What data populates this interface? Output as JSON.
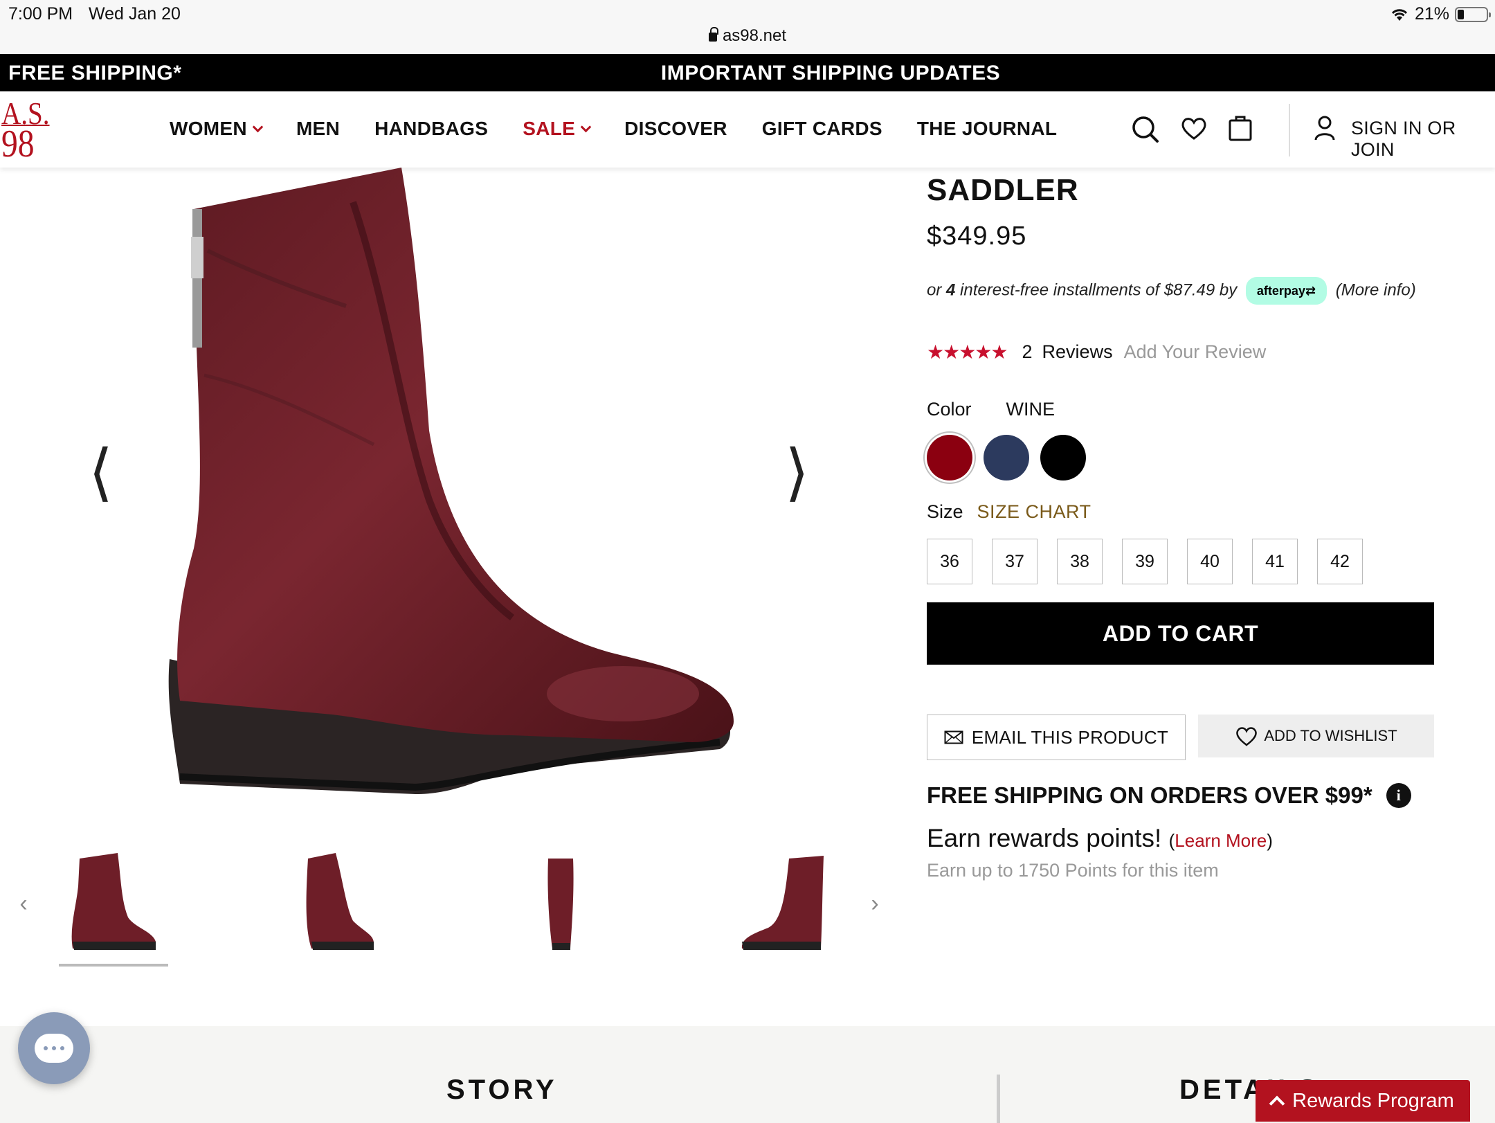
{
  "status": {
    "time": "7:00 PM",
    "date": "Wed Jan 20",
    "url": "as98.net",
    "battery": "21%"
  },
  "promo": {
    "left": "FREE SHIPPING*",
    "center": "IMPORTANT SHIPPING UPDATES"
  },
  "brand": {
    "logo_line1": "A.S.",
    "logo_line2": "98",
    "color": "#b3121f"
  },
  "nav": [
    "WOMEN",
    "MEN",
    "HANDBAGS",
    "SALE",
    "DISCOVER",
    "GIFT CARDS",
    "THE JOURNAL"
  ],
  "header": {
    "signin": "SIGN IN OR JOIN"
  },
  "gallery": {
    "prev": "⟨",
    "next": "⟩",
    "thumb_prev": "‹",
    "thumb_next": "›"
  },
  "product": {
    "title": "SADDLER",
    "price": "$349.95",
    "afterpay": {
      "pre": "or ",
      "count": "4",
      "mid": " interest-free installments of $87.49 by",
      "badge": "afterpay⇄",
      "more": "(More info)"
    },
    "rating": {
      "stars": "★★★★★",
      "count": "2",
      "reviews": "Reviews",
      "add": "Add Your Review",
      "value": 5
    },
    "color_label": "Color",
    "color_selected": "WINE",
    "swatches": [
      "#8b0010",
      "#2c3a5e",
      "#000000"
    ],
    "size_label": "Size",
    "size_chart": "SIZE CHART",
    "sizes": [
      "36",
      "37",
      "38",
      "39",
      "40",
      "41",
      "42"
    ],
    "add_to_cart": "ADD TO CART",
    "email": "EMAIL THIS PRODUCT",
    "wishlist": "ADD TO WISHLIST",
    "free_shipping": "FREE SHIPPING ON ORDERS OVER $99*",
    "rewards": "Earn rewards points!",
    "learn_more": "Learn More",
    "rewards_sub": "Earn up to 1750 Points for this item"
  },
  "bottom": {
    "story": "STORY",
    "details": "DETAILS",
    "rewards_program": "Rewards Program"
  }
}
